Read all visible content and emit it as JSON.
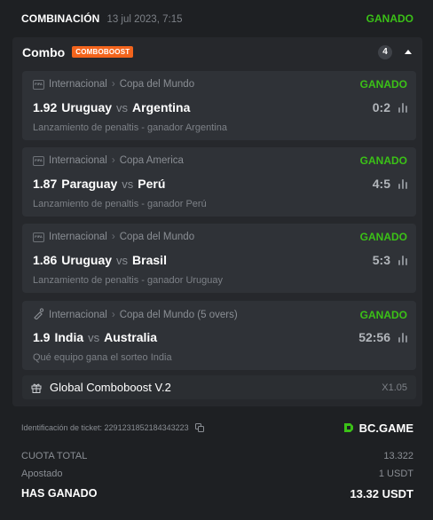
{
  "header": {
    "title": "COMBINACIÓN",
    "date": "13 jul 2023, 7:15",
    "status": "GANADO"
  },
  "combo": {
    "name": "Combo",
    "badge": "COMBOBOOST",
    "count": "4"
  },
  "matches": [
    {
      "league_icon": "fifa-icon",
      "league_icon_text": "FIFA",
      "league": "Internacional",
      "competition": "Copa del Mundo",
      "status": "GANADO",
      "odds": "1.92",
      "home": "Uruguay",
      "vs": "vs",
      "away": "Argentina",
      "score": "0:2",
      "market": "Lanzamiento de penaltis - ganador Argentina"
    },
    {
      "league_icon": "fifa-icon",
      "league_icon_text": "FIFA",
      "league": "Internacional",
      "competition": "Copa America",
      "status": "GANADO",
      "odds": "1.87",
      "home": "Paraguay",
      "vs": "vs",
      "away": "Perú",
      "score": "4:5",
      "market": "Lanzamiento de penaltis - ganador Perú"
    },
    {
      "league_icon": "fifa-icon",
      "league_icon_text": "FIFA",
      "league": "Internacional",
      "competition": "Copa del Mundo",
      "status": "GANADO",
      "odds": "1.86",
      "home": "Uruguay",
      "vs": "vs",
      "away": "Brasil",
      "score": "5:3",
      "market": "Lanzamiento de penaltis - ganador Uruguay"
    },
    {
      "league_icon": "cricket-icon",
      "league": "Internacional",
      "competition": "Copa del Mundo (5 overs)",
      "status": "GANADO",
      "odds": "1.9",
      "home": "India",
      "vs": "vs",
      "away": "Australia",
      "score": "52:56",
      "market": "Qué equipo gana el sorteo India"
    }
  ],
  "comboboost": {
    "icon": "gift-icon",
    "label": "Global Comboboost V.2",
    "multiplier": "X1.05"
  },
  "ticket": {
    "label": "Identificación de ticket: 2291231852184343223",
    "icon": "copy-icon"
  },
  "brand": {
    "name": "BC.GAME",
    "icon": "bc-game-logo-icon",
    "color": "#3bc117"
  },
  "totals": {
    "odds_label": "CUOTA TOTAL",
    "odds_value": "13.322",
    "stake_label": "Apostado",
    "stake_value": "1 USDT",
    "won_label": "HAS GANADO",
    "won_value": "13.32 USDT"
  },
  "colors": {
    "background": "#1e2023",
    "panel": "#26282c",
    "card": "#2f3237",
    "win": "#3bc117",
    "badge": "#f3641c"
  }
}
